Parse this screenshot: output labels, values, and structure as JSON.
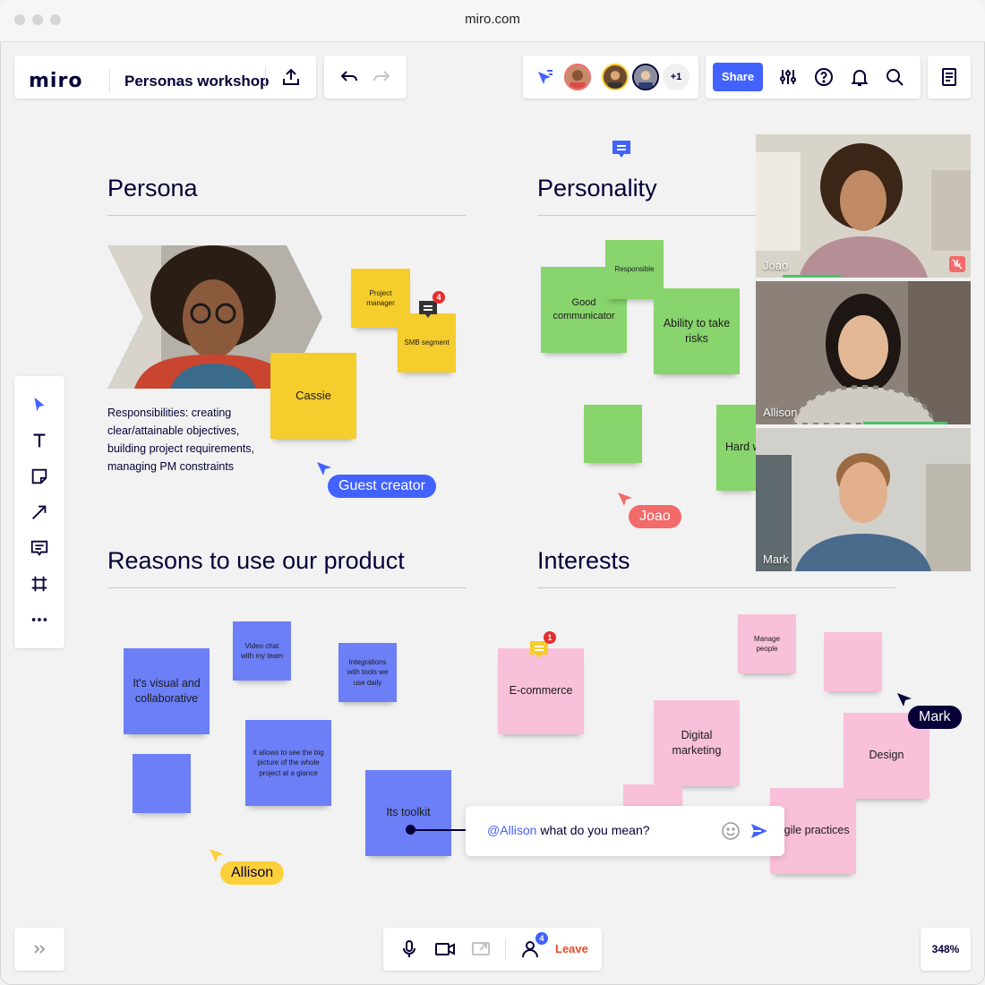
{
  "browser": {
    "url": "miro.com"
  },
  "header": {
    "logo": "miro",
    "board_title": "Personas workshop",
    "collaborators_more": "+1",
    "share_label": "Share",
    "icons": [
      "export-icon",
      "undo-icon",
      "redo-icon",
      "follow-cursor-icon",
      "settings-icon",
      "help-icon",
      "notification-icon",
      "search-icon",
      "notes-icon"
    ]
  },
  "sections": {
    "persona": {
      "title": "Persona",
      "description": "Responsibilities: creating clear/attainable objectives, building project requirements, managing PM constraints"
    },
    "personality": {
      "title": "Personality"
    },
    "reasons": {
      "title": "Reasons to use our product"
    },
    "interests": {
      "title": "Interests"
    }
  },
  "stickies": {
    "persona": {
      "project_manager": "Project manager",
      "smb_segment": "SMB segment",
      "cassie": "Cassie"
    },
    "personality": {
      "good_communicator": "Good communicator",
      "responsible": "Responsible",
      "ability_risks": "Ability to take risks",
      "hard": "Hard w"
    },
    "reasons": {
      "visual": "It's visual and collaborative",
      "video_chat": "Video chat with my team",
      "integrations": "Integrations with tools we use daily",
      "big_picture": "It allows to see the big picture of the whole project at a glance",
      "toolkit": "Its toolkit"
    },
    "interests": {
      "ecommerce": "E-commerce",
      "manage_people": "Manage people",
      "digital_marketing": "Digital marketing",
      "design": "Design",
      "agile": "Agile practices"
    }
  },
  "comment_badges": {
    "persona": "4",
    "interests": "1"
  },
  "cursors": {
    "guest": {
      "label": "Guest creator",
      "color": "#4262ff"
    },
    "joao": {
      "label": "Joao",
      "color": "#f26a6a"
    },
    "allison": {
      "label": "Allison",
      "color": "#fbd03a"
    },
    "mark": {
      "label": "Mark",
      "color": "#050038"
    }
  },
  "chat": {
    "mention": "@Allison",
    "message": " what do you mean?"
  },
  "video_tiles": [
    {
      "name": "Joao",
      "muted": true
    },
    {
      "name": "Allison",
      "muted": false
    },
    {
      "name": "Mark",
      "muted": false
    }
  ],
  "left_toolbar": {
    "tools": [
      "select-icon",
      "text-icon",
      "sticky-note-icon",
      "arrow-icon",
      "comment-icon",
      "frame-icon",
      "more-icon"
    ]
  },
  "bottom_bar": {
    "participants_count": "4",
    "leave_label": "Leave",
    "zoom": "348%"
  },
  "colors": {
    "accent": "#4262ff",
    "yellow_sticky": "#f5cd2c",
    "green_sticky": "#88d46d",
    "blue_sticky": "#6c7ff7",
    "pink_sticky": "#f9c0d9",
    "leave": "#f24726"
  }
}
